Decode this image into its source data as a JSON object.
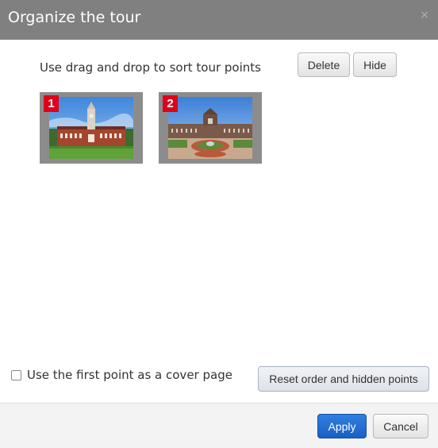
{
  "dialog": {
    "title": "Organize the tour",
    "close_symbol": "×"
  },
  "main": {
    "instructions": "Use drag and drop to sort tour points",
    "delete_label": "Delete",
    "hide_label": "Hide"
  },
  "tour_points": [
    {
      "number": "1",
      "image": "photo of red-brick building with clock tower and lawn"
    },
    {
      "number": "2",
      "image": "photo of building with courtyard garden and fountain"
    }
  ],
  "options": {
    "cover_page_label": "Use the first point as a cover page",
    "cover_page_checked": false,
    "reset_label": "Reset order and hidden points"
  },
  "footer": {
    "apply_label": "Apply",
    "cancel_label": "Cancel"
  },
  "colors": {
    "titlebar": "#808080",
    "badge": "#e0001b",
    "apply": "#1f66cc"
  }
}
